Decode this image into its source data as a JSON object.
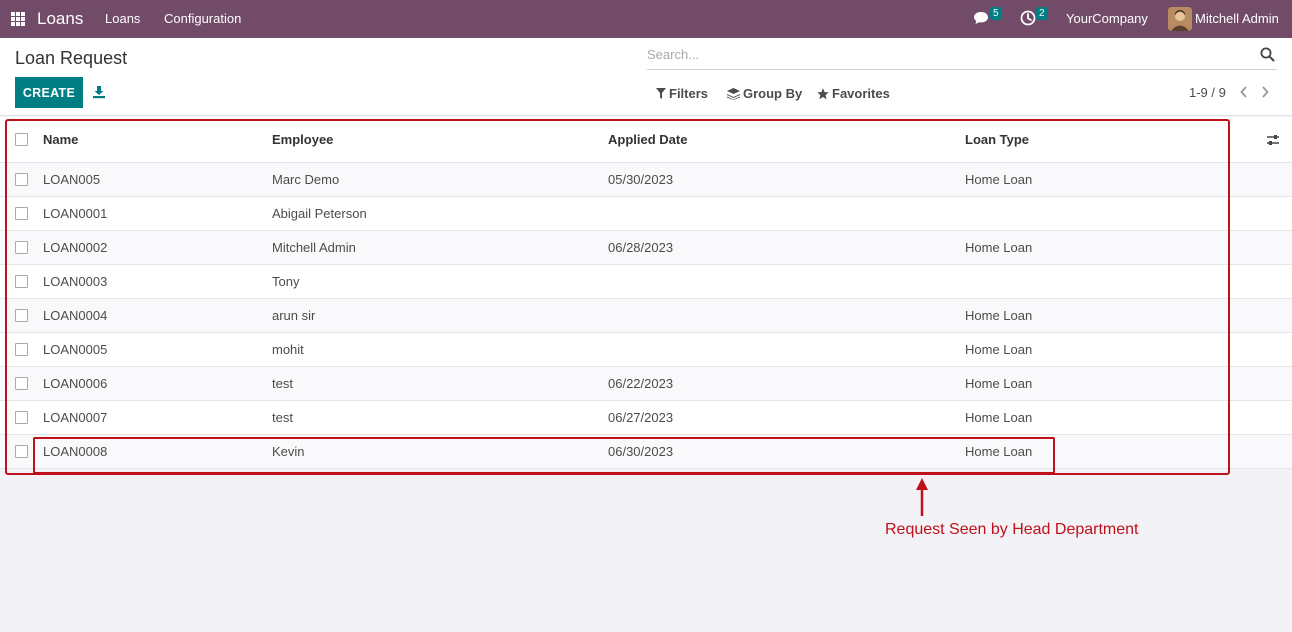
{
  "navbar": {
    "app_name": "Loans",
    "menu_loans": "Loans",
    "menu_configuration": "Configuration",
    "messages_count": "5",
    "activities_count": "2",
    "company": "YourCompany",
    "user_name": "Mitchell Admin"
  },
  "control_panel": {
    "title": "Loan Request",
    "create_label": "CREATE",
    "search_placeholder": "Search...",
    "filters_label": "Filters",
    "groupby_label": "Group By",
    "favorites_label": "Favorites",
    "pager": "1-9 / 9"
  },
  "table": {
    "headers": {
      "name": "Name",
      "employee": "Employee",
      "applied_date": "Applied Date",
      "loan_type": "Loan Type"
    },
    "rows": [
      {
        "name": "LOAN005",
        "employee": "Marc Demo",
        "applied_date": "05/30/2023",
        "loan_type": "Home Loan"
      },
      {
        "name": "LOAN0001",
        "employee": "Abigail Peterson",
        "applied_date": "",
        "loan_type": ""
      },
      {
        "name": "LOAN0002",
        "employee": "Mitchell Admin",
        "applied_date": "06/28/2023",
        "loan_type": "Home Loan"
      },
      {
        "name": "LOAN0003",
        "employee": "Tony",
        "applied_date": "",
        "loan_type": ""
      },
      {
        "name": "LOAN0004",
        "employee": "arun sir",
        "applied_date": "",
        "loan_type": "Home Loan"
      },
      {
        "name": "LOAN0005",
        "employee": "mohit",
        "applied_date": "",
        "loan_type": "Home Loan"
      },
      {
        "name": "LOAN0006",
        "employee": "test",
        "applied_date": "06/22/2023",
        "loan_type": "Home Loan"
      },
      {
        "name": "LOAN0007",
        "employee": "test",
        "applied_date": "06/27/2023",
        "loan_type": "Home Loan"
      },
      {
        "name": "LOAN0008",
        "employee": "Kevin",
        "applied_date": "06/30/2023",
        "loan_type": "Home Loan"
      }
    ]
  },
  "annotation": {
    "text": "Request Seen by Head Department",
    "color": "#c0101a"
  },
  "colors": {
    "navbar": "#714b67",
    "primary_button": "#017e84"
  }
}
